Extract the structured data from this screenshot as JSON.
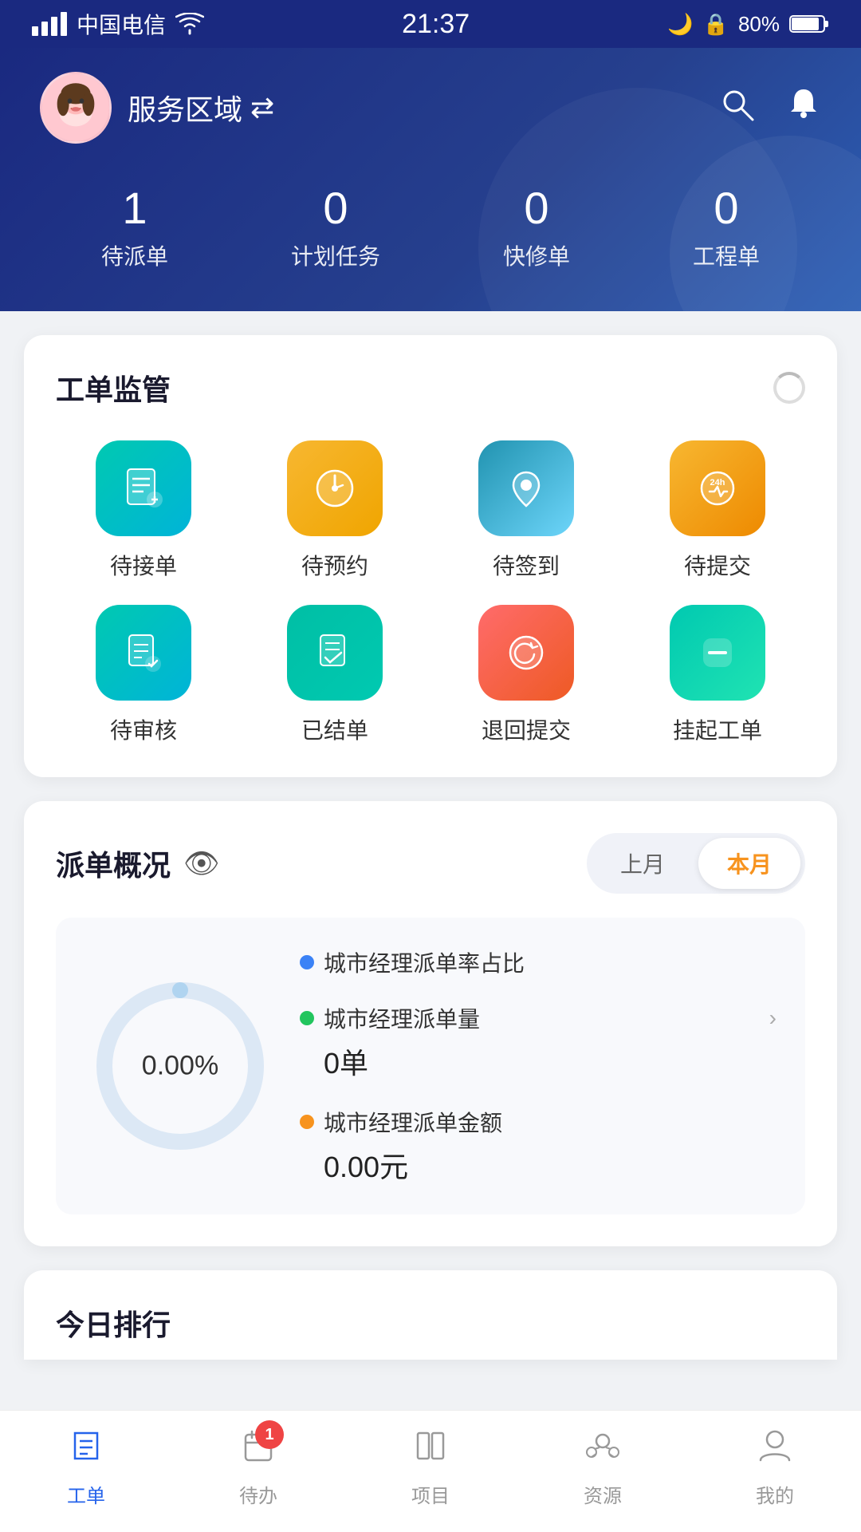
{
  "statusBar": {
    "carrier": "中国电信",
    "time": "21:37",
    "battery": "80%"
  },
  "header": {
    "serviceArea": "服务区域",
    "switchIcon": "⇄",
    "stats": [
      {
        "key": "pending_dispatch",
        "number": "1",
        "label": "待派单"
      },
      {
        "key": "planned_tasks",
        "number": "0",
        "label": "计划任务"
      },
      {
        "key": "quick_repair",
        "number": "0",
        "label": "快修单"
      },
      {
        "key": "engineering",
        "number": "0",
        "label": "工程单"
      }
    ]
  },
  "workOrderSection": {
    "title": "工单监管",
    "items": [
      {
        "key": "pending_accept",
        "label": "待接单",
        "colorClass": "icon-teal"
      },
      {
        "key": "pending_appt",
        "label": "待预约",
        "colorClass": "icon-orange"
      },
      {
        "key": "pending_checkin",
        "label": "待签到",
        "colorClass": "icon-blue"
      },
      {
        "key": "pending_submit",
        "label": "待提交",
        "colorClass": "icon-gold"
      },
      {
        "key": "pending_review",
        "label": "待审核",
        "colorClass": "icon-teal2"
      },
      {
        "key": "completed",
        "label": "已结单",
        "colorClass": "icon-teal3"
      },
      {
        "key": "returned",
        "label": "退回提交",
        "colorClass": "icon-coral"
      },
      {
        "key": "suspended",
        "label": "挂起工单",
        "colorClass": "icon-cyan"
      }
    ]
  },
  "dispatchSection": {
    "title": "派单概况",
    "lastMonthLabel": "上月",
    "thisMonthLabel": "本月",
    "activeMonth": "thisMonth",
    "donutPercent": "0.00%",
    "stats": [
      {
        "key": "rate",
        "dotColor": "dot-blue",
        "label": "城市经理派单率占比",
        "hasArrow": false,
        "value": null
      },
      {
        "key": "count",
        "dotColor": "dot-green",
        "label": "城市经理派单量",
        "hasArrow": true,
        "value": "0单"
      },
      {
        "key": "amount",
        "dotColor": "dot-orange",
        "label": "城市经理派单金额",
        "hasArrow": false,
        "value": "0.00元"
      }
    ]
  },
  "bottomPeek": {
    "title": "今日排行"
  },
  "bottomNav": [
    {
      "key": "workorder",
      "label": "工单",
      "active": true,
      "badge": null
    },
    {
      "key": "pending",
      "label": "待办",
      "active": false,
      "badge": "1"
    },
    {
      "key": "project",
      "label": "项目",
      "active": false,
      "badge": null
    },
    {
      "key": "resource",
      "label": "资源",
      "active": false,
      "badge": null
    },
    {
      "key": "mine",
      "label": "我的",
      "active": false,
      "badge": null
    }
  ]
}
